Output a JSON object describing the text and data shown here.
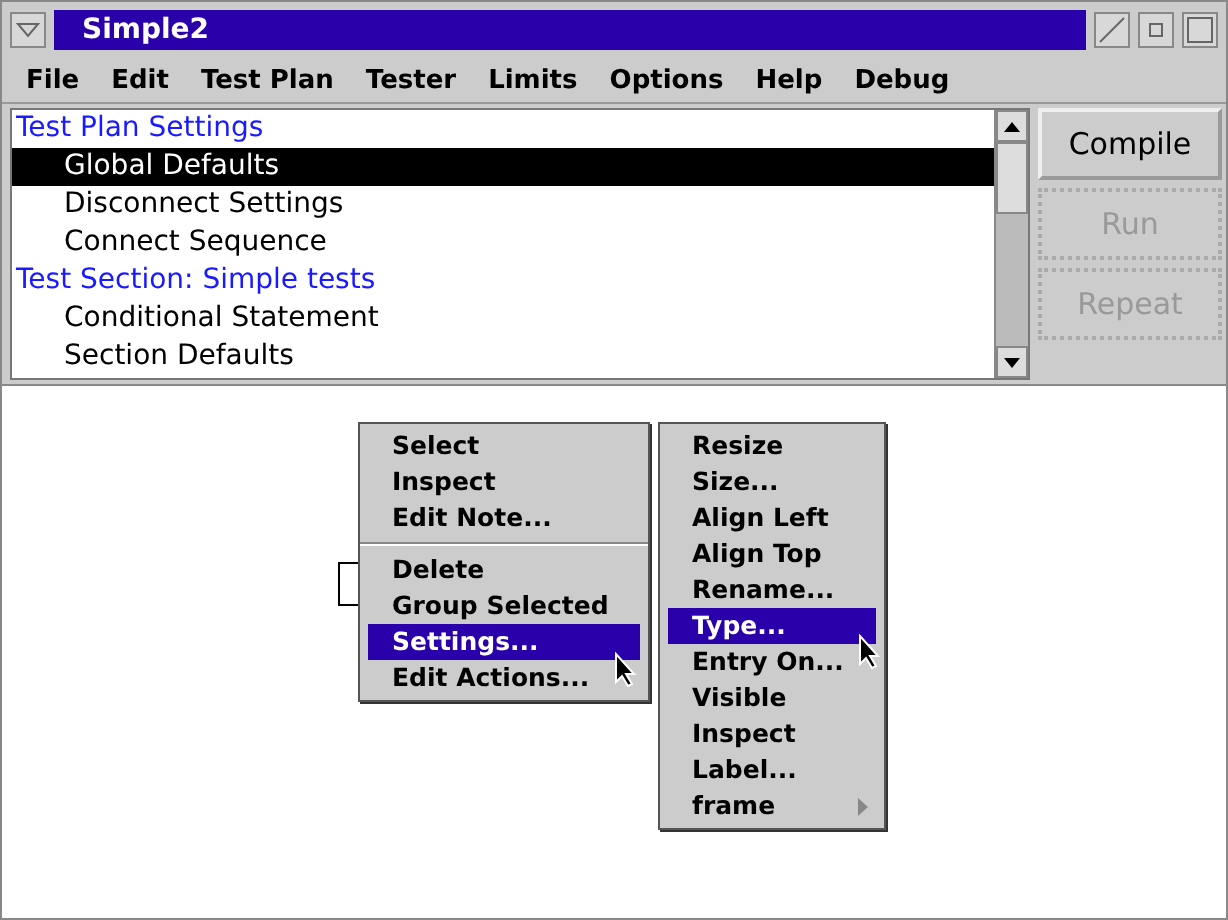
{
  "window": {
    "title": "Simple2"
  },
  "menu_bar": [
    "File",
    "Edit",
    "Test Plan",
    "Tester",
    "Limits",
    "Options",
    "Help",
    "Debug"
  ],
  "tree": [
    {
      "label": "Test Plan Settings",
      "selected": false,
      "children": [
        {
          "label": "Global Defaults",
          "selected": true
        },
        {
          "label": "Disconnect Settings",
          "selected": false
        },
        {
          "label": "Connect Sequence",
          "selected": false
        }
      ]
    },
    {
      "label": "Test Section: Simple tests",
      "selected": false,
      "children": [
        {
          "label": "Conditional Statement",
          "selected": false
        },
        {
          "label": "Section Defaults",
          "selected": false
        }
      ]
    }
  ],
  "buttons": [
    {
      "label": "Compile",
      "disabled": false
    },
    {
      "label": "Run",
      "disabled": true
    },
    {
      "label": "Repeat",
      "disabled": true
    }
  ],
  "context_menu": [
    [
      {
        "label": "Select",
        "selected": false
      },
      {
        "label": "Inspect",
        "selected": false
      },
      {
        "label": "Edit Note...",
        "selected": false
      }
    ],
    [
      {
        "label": "Delete",
        "selected": false
      },
      {
        "label": "Group Selected",
        "selected": false
      },
      {
        "label": "Settings...",
        "selected": true
      },
      {
        "label": "Edit Actions...",
        "selected": false
      }
    ]
  ],
  "submenu": [
    {
      "label": "Resize",
      "selected": false
    },
    {
      "label": "Size...",
      "selected": false
    },
    {
      "label": "Align Left",
      "selected": false
    },
    {
      "label": "Align Top",
      "selected": false
    },
    {
      "label": "Rename...",
      "selected": false
    },
    {
      "label": "Type...",
      "selected": true
    },
    {
      "label": "Entry On...",
      "selected": false
    },
    {
      "label": "Visible",
      "selected": false
    },
    {
      "label": "Inspect",
      "selected": false
    },
    {
      "label": "Label...",
      "selected": false
    },
    {
      "label": "frame",
      "selected": false,
      "has_submenu": true
    }
  ]
}
